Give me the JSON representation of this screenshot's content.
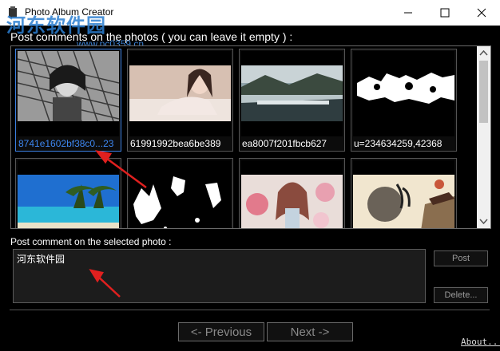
{
  "window": {
    "title": "Photo Album Creator",
    "watermark": "河东软件园",
    "watermark_url": "www.pc0359.cn",
    "minimize_icon": "minimize-icon",
    "maximize_icon": "maximize-icon",
    "close_icon": "close-icon"
  },
  "gallery": {
    "prompt": "Post comments on the photos ( you can leave it empty ) :",
    "photos": [
      {
        "caption": "8741e1602bf38c0...23",
        "selected": true
      },
      {
        "caption": "61991992bea6be389",
        "selected": false
      },
      {
        "caption": "ea8007f201fbcb627",
        "selected": false
      },
      {
        "caption": "u=234634259,42368",
        "selected": false
      },
      {
        "caption": "",
        "selected": false
      },
      {
        "caption": "",
        "selected": false
      },
      {
        "caption": "",
        "selected": false
      },
      {
        "caption": "",
        "selected": false
      }
    ]
  },
  "comment": {
    "label": "Post comment on the selected photo :",
    "value": "河东软件园",
    "post_label": "Post",
    "delete_label": "Delete..."
  },
  "nav": {
    "previous_label": "<- Previous",
    "next_label": "Next ->",
    "about_label": "About..."
  },
  "colors": {
    "background": "#000000",
    "selected_caption": "#3d86f0",
    "annotation_arrow": "#e0201f"
  }
}
